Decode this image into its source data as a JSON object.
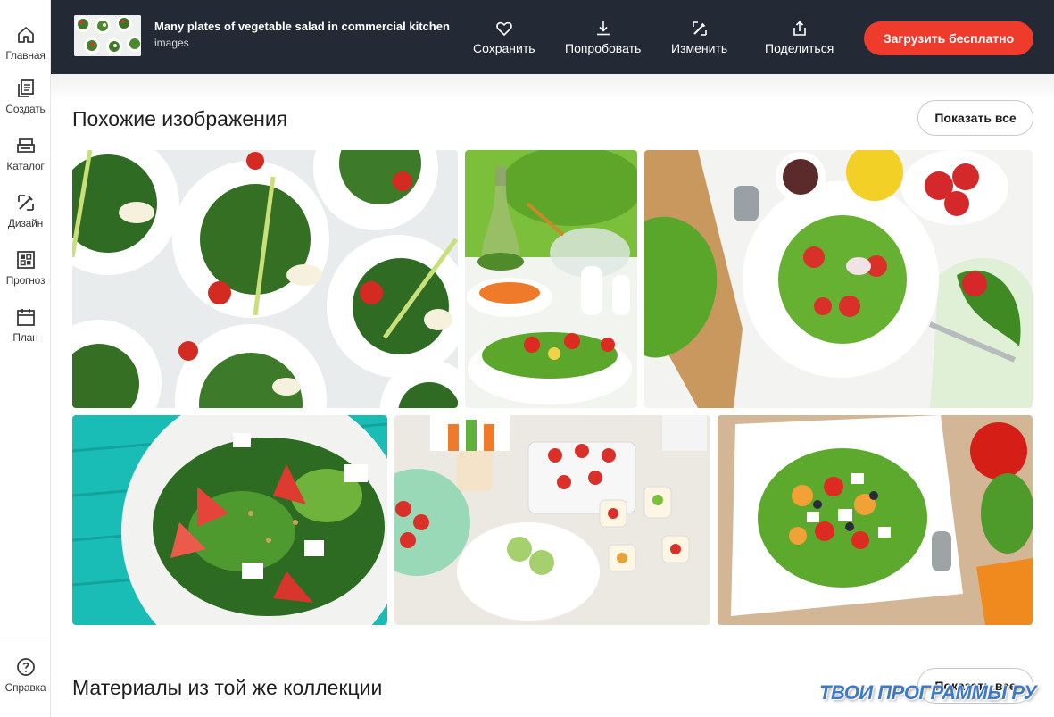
{
  "sidebar": {
    "items": [
      {
        "label": "Главная",
        "icon": "home-icon"
      },
      {
        "label": "Создать",
        "icon": "create-icon"
      },
      {
        "label": "Каталог",
        "icon": "catalog-icon"
      },
      {
        "label": "Дизайн",
        "icon": "design-icon"
      },
      {
        "label": "Прогноз",
        "icon": "forecast-icon"
      },
      {
        "label": "План",
        "icon": "calendar-icon"
      }
    ],
    "help": {
      "label": "Справка",
      "icon": "help-icon"
    }
  },
  "header": {
    "title": "Many plates of vegetable salad in commercial kitchen",
    "type": "images",
    "actions": [
      {
        "label": "Сохранить",
        "icon": "heart-icon"
      },
      {
        "label": "Попробовать",
        "icon": "download-icon"
      },
      {
        "label": "Изменить",
        "icon": "edit-icon"
      },
      {
        "label": "Поделиться",
        "icon": "share-icon"
      }
    ],
    "cta": "Загрузить бесплатно"
  },
  "similar": {
    "title": "Похожие изображения",
    "show_all": "Показать все",
    "images": [
      "salad-plates-overhead",
      "salads-with-oil-bottle",
      "salad-plate-strawberries",
      "salad-strawberry-feta",
      "canape-appetizers",
      "greek-salad-plate"
    ]
  },
  "collection": {
    "title": "Материалы из той же коллекции",
    "show_all": "Показать все"
  },
  "watermark": "ТВОИ ПРОГРАММЫ РУ",
  "colors": {
    "header_bg": "#232a36",
    "cta_bg": "#ef3b2c",
    "watermark": "#3f79c7"
  }
}
